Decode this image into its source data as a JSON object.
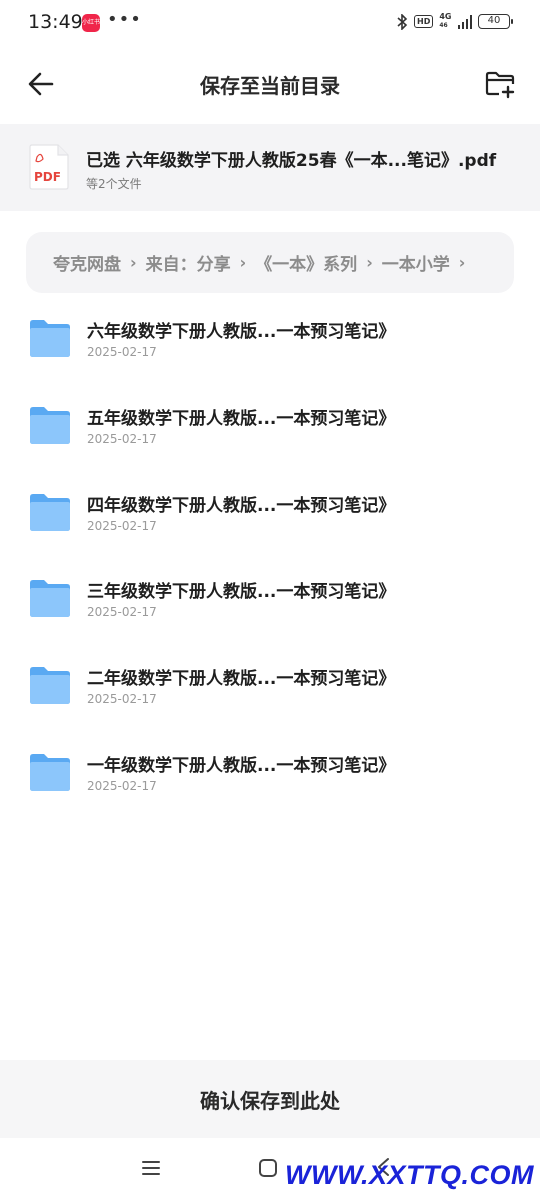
{
  "status_bar": {
    "time": "13:49",
    "app_badge": "小红书",
    "dots": "•••",
    "hd": "HD",
    "network": "4G",
    "network_sub": "46",
    "battery": "40"
  },
  "header": {
    "title": "保存至当前目录",
    "back_icon": "arrow-left-icon",
    "new_folder_icon": "folder-add-icon"
  },
  "selected_file": {
    "icon_label": "PDF",
    "title": "已选 六年级数学下册人教版25春《一本...笔记》.pdf",
    "subtitle": "等2个文件"
  },
  "breadcrumb": [
    "夸克网盘",
    "来自：分享",
    "《一本》系列",
    "一本小学"
  ],
  "breadcrumb_separator": "›",
  "folders": [
    {
      "name": "六年级数学下册人教版...一本预习笔记》",
      "date": "2025-02-17"
    },
    {
      "name": "五年级数学下册人教版...一本预习笔记》",
      "date": "2025-02-17"
    },
    {
      "name": "四年级数学下册人教版...一本预习笔记》",
      "date": "2025-02-17"
    },
    {
      "name": "三年级数学下册人教版...一本预习笔记》",
      "date": "2025-02-17"
    },
    {
      "name": "二年级数学下册人教版...一本预习笔记》",
      "date": "2025-02-17"
    },
    {
      "name": "一年级数学下册人教版...一本预习笔记》",
      "date": "2025-02-17"
    }
  ],
  "confirm": {
    "label": "确认保存到此处"
  },
  "nav": {
    "menu_icon": "menu-icon",
    "home_icon": "home-icon",
    "back_icon": "back-icon"
  },
  "watermark": "WWW.XXTTQ.COM",
  "colors": {
    "folder": "#5aa9f2",
    "pdf_red": "#e5453d",
    "watermark": "#1a23d8",
    "background_panel": "#f4f4f6"
  }
}
